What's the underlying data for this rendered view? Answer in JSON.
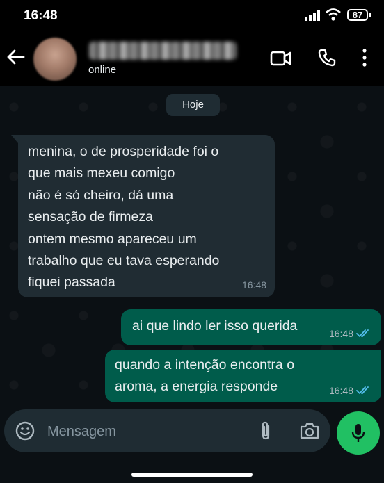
{
  "status_bar": {
    "time": "16:48",
    "battery": "87"
  },
  "header": {
    "contact_status": "online"
  },
  "chat": {
    "date_label": "Hoje",
    "messages": [
      {
        "direction": "in",
        "text": "menina, o de prosperidade foi o\nque mais mexeu comigo\nnão é só cheiro, dá uma\nsensação de firmeza\nontem mesmo apareceu um\ntrabalho que eu tava esperando\nfiquei passada",
        "time": "16:48"
      },
      {
        "direction": "out",
        "text": "ai que lindo ler isso querida",
        "time": "16:48",
        "status": "read"
      },
      {
        "direction": "out",
        "text": "quando a intenção encontra o\naroma, a energia responde",
        "time": "16:48",
        "status": "read"
      }
    ]
  },
  "composer": {
    "placeholder": "Mensagem"
  },
  "colors": {
    "accent": "#21c063",
    "outgoing_bubble": "#005c4b",
    "incoming_bubble": "#202c33",
    "read_ticks": "#53bdeb"
  },
  "icons": [
    "back-arrow-icon",
    "video-call-icon",
    "voice-call-icon",
    "more-options-icon",
    "emoji-icon",
    "attach-icon",
    "camera-icon",
    "mic-icon",
    "read-receipt-icon",
    "signal-icon",
    "wifi-icon"
  ]
}
